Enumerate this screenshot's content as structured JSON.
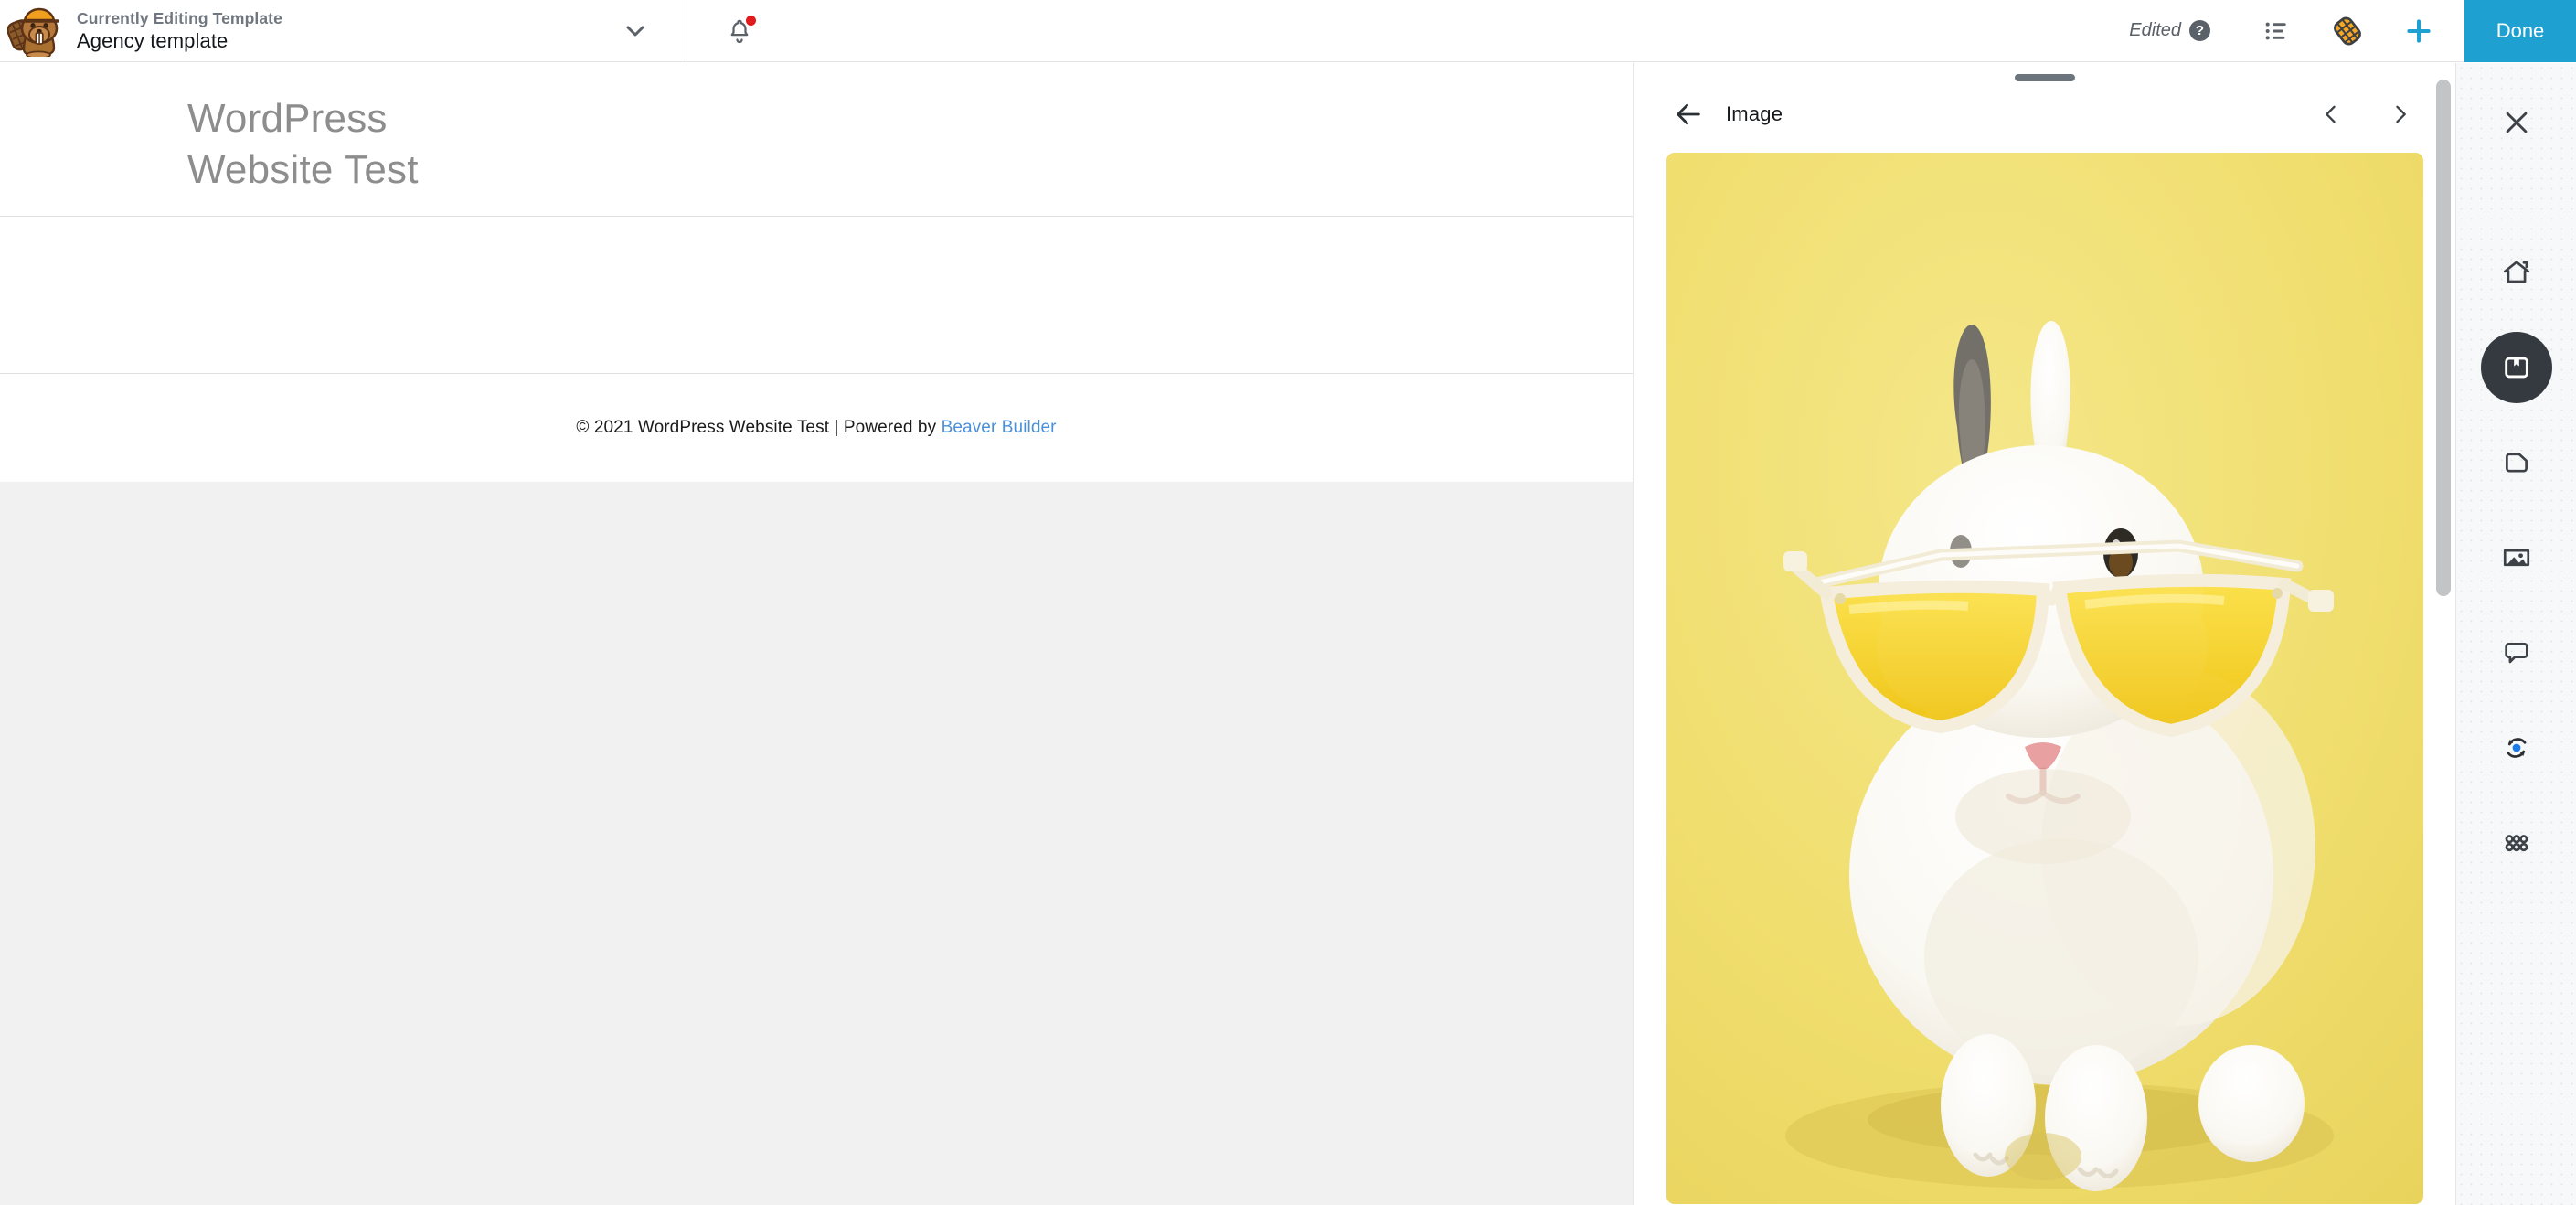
{
  "topbar": {
    "logo_icon": "beaver-builder-logo",
    "eyebrow": "Currently Editing Template",
    "template_name": "Agency template",
    "caret_icon": "chevron-down-icon",
    "bell_icon": "notification-bell-icon",
    "edited_label": "Edited",
    "help_label": "?",
    "help_icon": "help-circle-icon",
    "outline_icon": "outline-list-icon",
    "tools_icon": "beaver-tail-tools-icon",
    "add_icon": "plus-icon",
    "done_label": "Done",
    "accent_blue": "#1EA0D1"
  },
  "canvas": {
    "site_title": "WordPress Website Test",
    "footer_text": "© 2021 WordPress Website Test | Powered by ",
    "footer_link": "Beaver Builder",
    "link_color": "#4A90D9",
    "page_bg": "#FFFFFF",
    "outer_bg": "#F1F1F1"
  },
  "panel": {
    "grip": "drag-handle",
    "back_icon": "arrow-left-icon",
    "title": "Image",
    "prev_icon": "chevron-left-icon",
    "next_icon": "chevron-right-icon",
    "photo": {
      "name": "rabbit-sunglasses-photo",
      "bg_color": "#F0DE6E",
      "subject": "white rabbit wearing yellow sunglasses",
      "lens_color": "#F5D020",
      "fur_color": "#FDFDFB",
      "ear_gray": "#6E6A63",
      "nose_pink": "#E8A0A0"
    }
  },
  "rail": {
    "close_icon": "close-icon",
    "items": [
      {
        "icon": "home-icon",
        "name": "home",
        "active": false
      },
      {
        "icon": "saved-library-icon",
        "name": "saved",
        "active": true
      },
      {
        "icon": "page-file-icon",
        "name": "pages",
        "active": false
      },
      {
        "icon": "image-icon",
        "name": "media",
        "active": false
      },
      {
        "icon": "comment-bubble-icon",
        "name": "comments",
        "active": false
      },
      {
        "icon": "sync-refresh-icon",
        "name": "updates",
        "active": false
      },
      {
        "icon": "apps-grid-icon",
        "name": "apps",
        "active": false
      }
    ],
    "active_bg": "#343A40",
    "accent_dot": "#1B7BE8"
  },
  "scrollbar": {
    "name": "vertical-scrollbar",
    "thumb_color": "#C3C4C6"
  }
}
